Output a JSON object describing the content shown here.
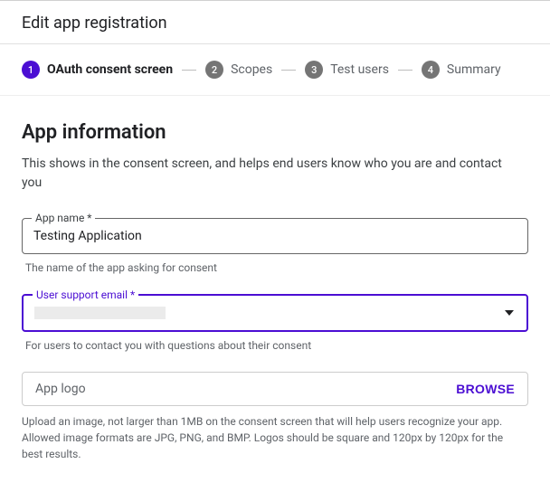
{
  "page_title": "Edit app registration",
  "stepper": {
    "steps": [
      {
        "num": "1",
        "label": "OAuth consent screen",
        "active": true
      },
      {
        "num": "2",
        "label": "Scopes",
        "active": false
      },
      {
        "num": "3",
        "label": "Test users",
        "active": false
      },
      {
        "num": "4",
        "label": "Summary",
        "active": false
      }
    ]
  },
  "section": {
    "heading": "App information",
    "desc": "This shows in the consent screen, and helps end users know who you are and contact you"
  },
  "app_name": {
    "label": "App name *",
    "value": "Testing Application",
    "helper": "The name of the app asking for consent"
  },
  "support_email": {
    "label": "User support email *",
    "value": "",
    "helper": "For users to contact you with questions about their consent"
  },
  "app_logo": {
    "label": "App logo",
    "browse": "BROWSE",
    "helper": "Upload an image, not larger than 1MB on the consent screen that will help users recognize your app. Allowed image formats are JPG, PNG, and BMP. Logos should be square and 120px by 120px for the best results."
  }
}
